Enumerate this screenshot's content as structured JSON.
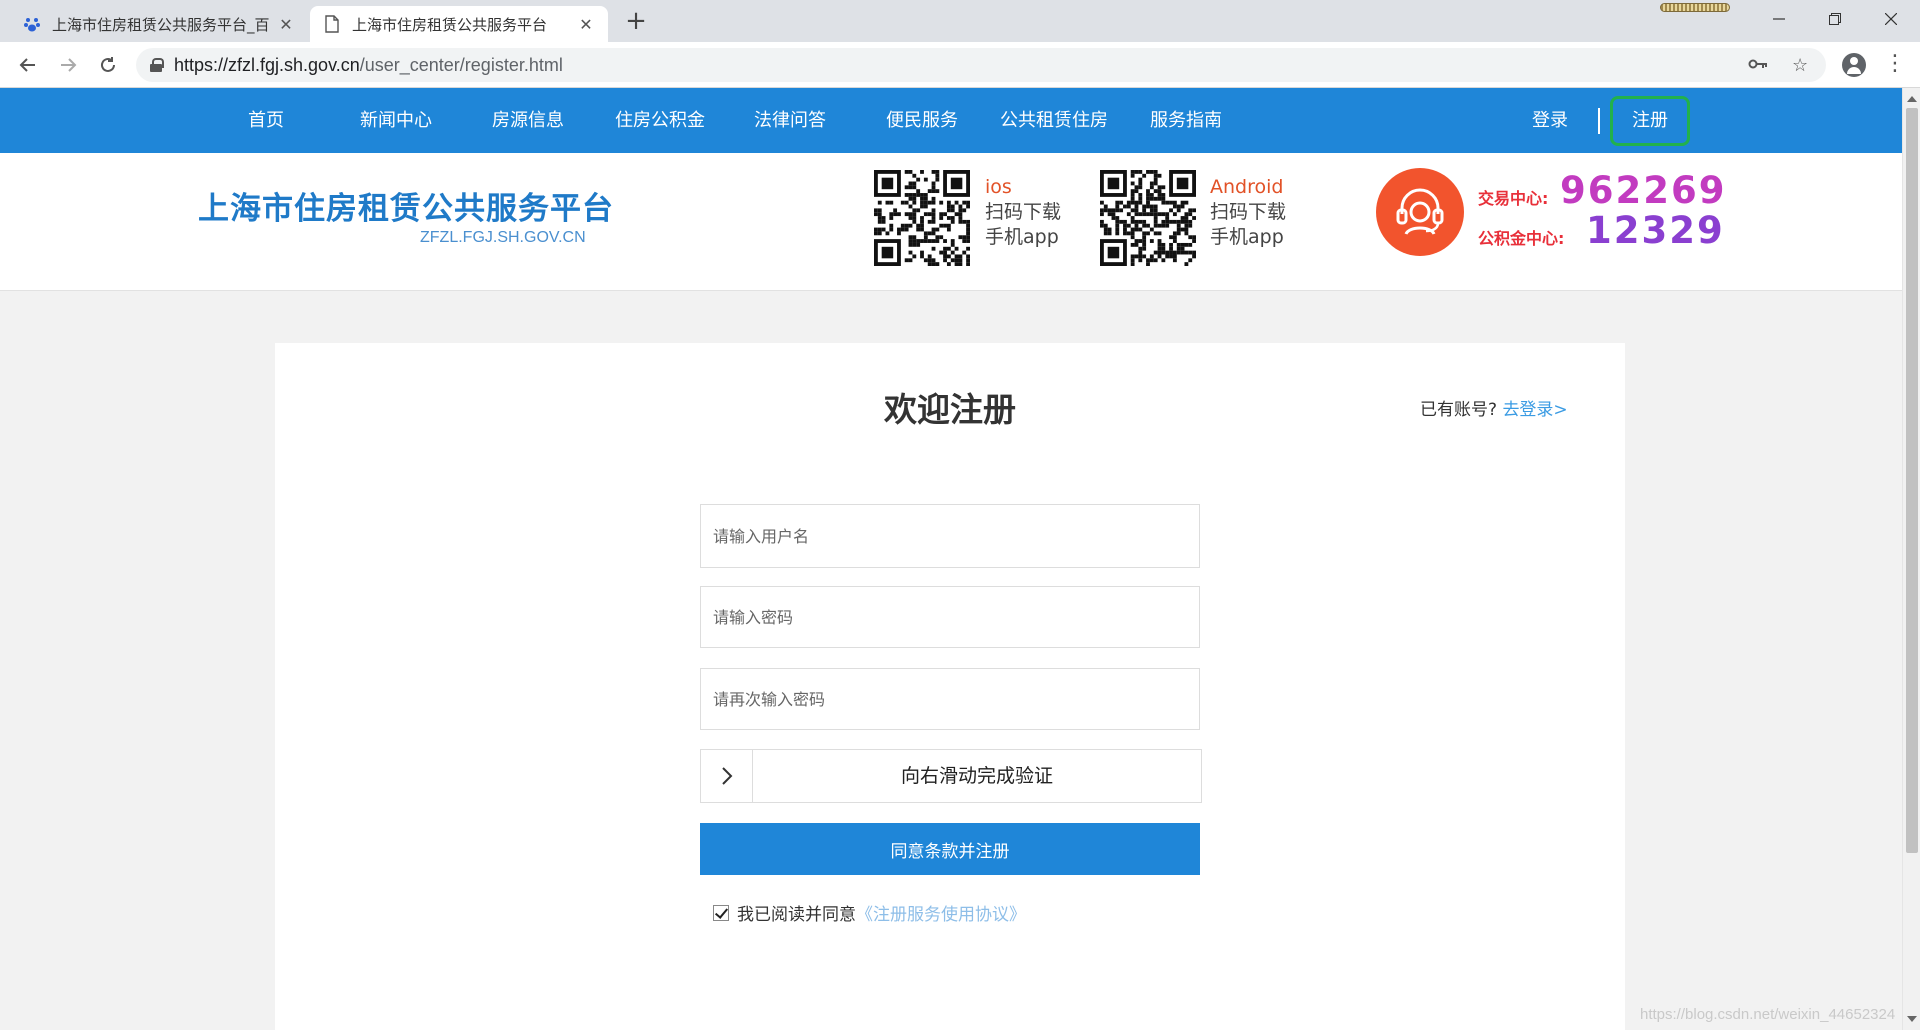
{
  "browser": {
    "tabs": [
      {
        "title": "上海市住房租赁公共服务平台_百",
        "icon": "paw-icon"
      },
      {
        "title": "上海市住房租赁公共服务平台",
        "icon": "page-icon"
      }
    ],
    "url_host": "https://zfzl.fgj.sh.gov.cn",
    "url_path": "/user_center/register.html"
  },
  "nav": {
    "items": [
      "首页",
      "新闻中心",
      "房源信息",
      "住房公积金",
      "法律问答",
      "便民服务",
      "公共租赁住房",
      "服务指南"
    ],
    "login": "登录",
    "register": "注册"
  },
  "header": {
    "title": "上海市住房租赁公共服务平台",
    "subtitle": "ZFZL.FGJ.SH.GOV.CN",
    "ios": {
      "os": "ios",
      "line1": "扫码下载",
      "line2": "手机app"
    },
    "android": {
      "os": "Android",
      "line1": "扫码下载",
      "line2": "手机app"
    },
    "hotline1_label": "交易中心:",
    "hotline1_number": "962269",
    "hotline2_label": "公积金中心:",
    "hotline2_number": "12329"
  },
  "form": {
    "title": "欢迎注册",
    "have_account": "已有账号?",
    "login_link": "去登录>",
    "username_placeholder": "请输入用户名",
    "password_placeholder": "请输入密码",
    "confirm_placeholder": "请再次输入密码",
    "slider_text": "向右滑动完成验证",
    "submit_label": "同意条款并注册",
    "agree_checked": true,
    "agree_text": "我已阅读并同意",
    "agree_link": "《注册服务使用协议》"
  },
  "watermark": "https://blog.csdn.net/weixin_44652324",
  "colors": {
    "nav_blue": "#1f86d8",
    "highlight_green": "#22b14c",
    "phone_red": "#f2542d"
  }
}
